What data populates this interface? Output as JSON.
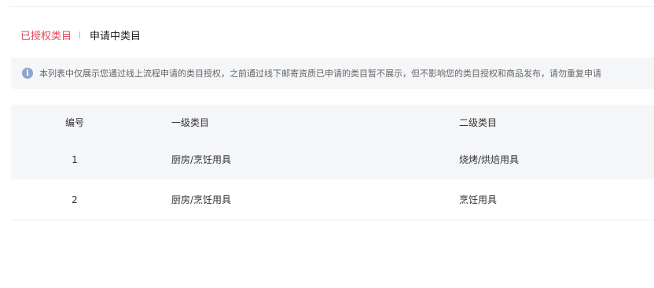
{
  "tabs": [
    {
      "label": "已授权类目",
      "active": true
    },
    {
      "label": "申请中类目",
      "active": false
    }
  ],
  "notice": {
    "icon": "info-icon",
    "text": "本列表中仅展示您通过线上流程申请的类目授权，之前通过线下邮寄资质已申请的类目暂不展示，但不影响您的类目授权和商品发布，请勿重复申请"
  },
  "table": {
    "headers": {
      "no": "编号",
      "level1": "一级类目",
      "level2": "二级类目"
    },
    "rows": [
      {
        "no": "1",
        "level1": "厨房/烹饪用具",
        "level2": "烧烤/烘焙用具"
      },
      {
        "no": "2",
        "level1": "厨房/烹饪用具",
        "level2": "烹饪用具"
      }
    ]
  },
  "colors": {
    "accent": "#e8455c",
    "notice_bg": "#f5f6f8",
    "info_icon": "#8fa3cc"
  }
}
